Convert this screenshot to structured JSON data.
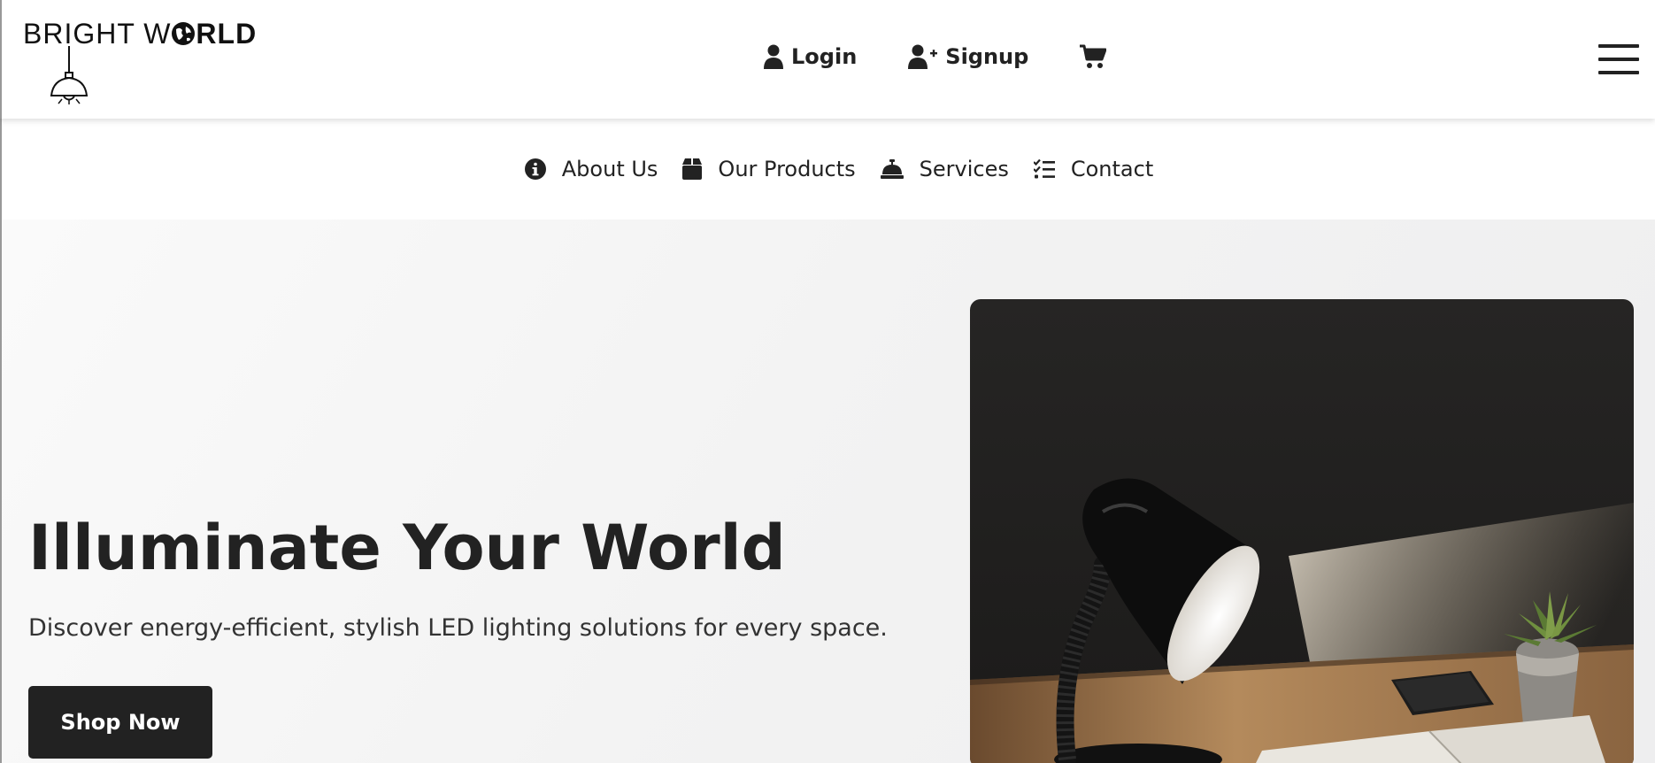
{
  "brand": {
    "light": "BRIGHT W",
    "globe": "O",
    "bold": "RLD"
  },
  "auth": {
    "login": "Login",
    "signup": "Signup"
  },
  "icons": {
    "user": "user-icon",
    "user_plus": "user-plus-icon",
    "cart": "shopping-cart-icon",
    "menu": "hamburger-menu-icon",
    "info": "info-circle-icon",
    "box": "box-icon",
    "bell": "concierge-bell-icon",
    "list": "list-check-icon",
    "lamp": "pendant-lamp-icon",
    "globe": "globe-icon"
  },
  "subnav": [
    {
      "label": "About Us",
      "icon": "info-circle-icon"
    },
    {
      "label": "Our Products",
      "icon": "box-icon"
    },
    {
      "label": "Services",
      "icon": "concierge-bell-icon"
    },
    {
      "label": "Contact",
      "icon": "list-check-icon"
    }
  ],
  "hero": {
    "title": "Illuminate Your World",
    "subtitle": "Discover energy-efficient, stylish LED lighting solutions for every space.",
    "cta": "Shop Now",
    "image_subject": "desk lamp shining on an open book, phone and potted succulent"
  },
  "colors": {
    "text": "#222222",
    "button": "#222222",
    "hero_bg": "#f3f3f3"
  }
}
